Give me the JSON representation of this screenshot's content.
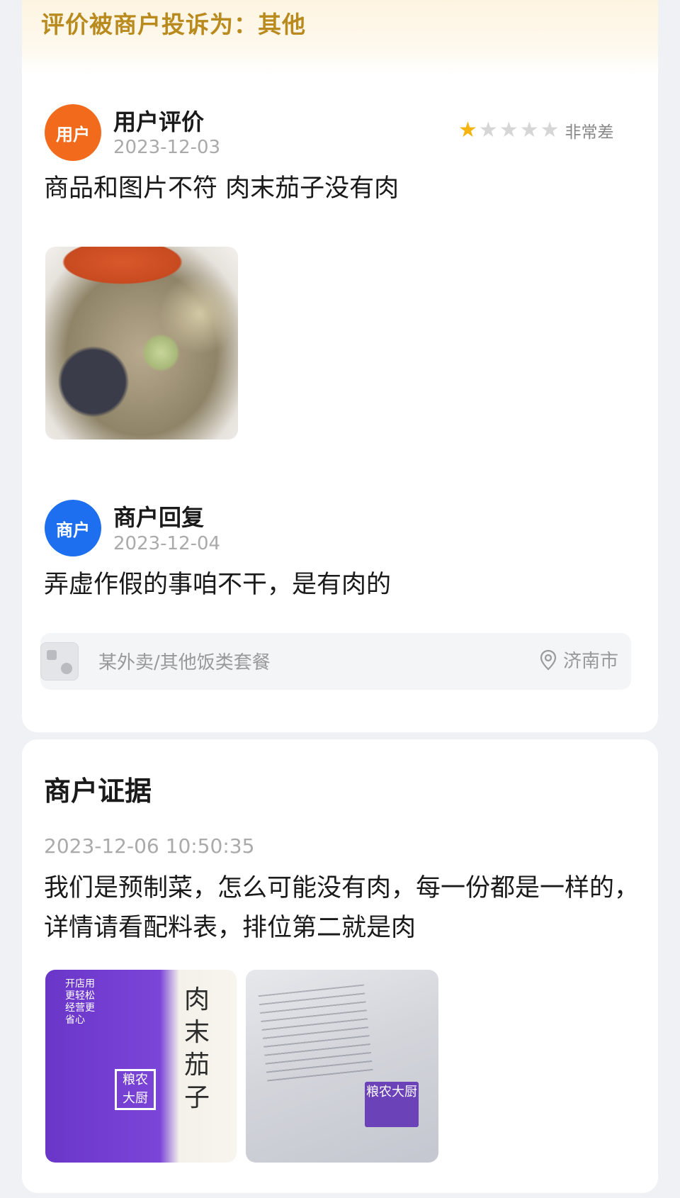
{
  "complaint": {
    "text": "评价被商户投诉为：其他"
  },
  "user_review": {
    "avatar_label": "用户",
    "title": "用户评价",
    "date": "2023-12-03",
    "rating": {
      "stars": 1,
      "max": 5,
      "label": "非常差"
    },
    "text": "商品和图片不符 肉末茄子没有肉"
  },
  "merchant_reply": {
    "avatar_label": "商户",
    "title": "商户回复",
    "date": "2023-12-04",
    "text": "弄虚作假的事咱不干，是有肉的"
  },
  "product": {
    "name": "某外卖/其他饭类套餐",
    "location": "济南市"
  },
  "evidence": {
    "title": "商户证据",
    "datetime": "2023-12-06 10:50:35",
    "text": "我们是预制菜，怎么可能没有肉，每一份都是一样的，详情请看配料表，排位第二就是肉",
    "package_label": "肉末茄子",
    "package_brand": "粮农大厨",
    "package_slogan": "开店用更轻松经营更省心"
  },
  "colors": {
    "user_avatar": "#f26b1d",
    "merchant_avatar": "#1e6ff0",
    "complaint_text": "#b98a1e",
    "star_on": "#f6b40e",
    "star_off": "#d6d6d6"
  }
}
